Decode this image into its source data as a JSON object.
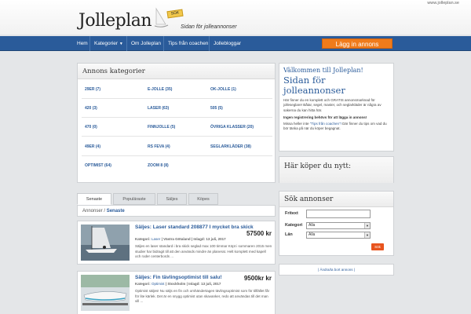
{
  "header": {
    "site_url": "www.jolleplan.se",
    "logo_text": "Jolleplan",
    "logo_badge": "SOK",
    "tagline": "Sidan för jolleannonser"
  },
  "nav": {
    "items": [
      "Hem",
      "Kategorier",
      "Om Jolleplan",
      "Tips från coachen",
      "Jollebloggar"
    ],
    "dropdown_icon": "caret-down-icon",
    "cta_label": "Lägg in annons"
  },
  "categories": {
    "title": "Annons kategorier",
    "items": [
      "29ER (7)",
      "E-JOLLE (35)",
      "OK-JOLLE (1)",
      "420 (3)",
      "LASER (63)",
      "505 (5)",
      "470 (0)",
      "FINNJOLLE (5)",
      "ÖVRIGA KLASSER (20)",
      "49ER (4)",
      "RS FEVA (4)",
      "SEGLARKLÄDER (38)",
      "OPTIMIST (64)",
      "ZOOM 8 (8)",
      ""
    ]
  },
  "tabs": {
    "items": [
      "Senaste",
      "Populäraste",
      "Säljes",
      "Köpes"
    ],
    "active": "Senaste"
  },
  "breadcrumb": {
    "root": "Annonser",
    "separator": "/",
    "current": "Senaste"
  },
  "listings": [
    {
      "title": "Säljes: Laser standard 208877 I mycket bra skick",
      "price": "57500 kr",
      "meta_prefix": "Kategori:",
      "category": "Laser",
      "meta_suffix": "| Västra Götaland | Inlagd: 13 juli, 2017",
      "description": "Säljes en laser standard i bra skick seglad max 100 timmar Köpt i sommaren 2015 men studier har bidragit till att den används mindre än planerat. Helt komplett med kapell och roder centerbords ..."
    },
    {
      "title": "Säljes: Fin tävlingsoptimist till salu!",
      "price": "9500kr kr",
      "meta_prefix": "Kategori:",
      "category": "Optimist",
      "meta_suffix": "| Stockholm | Inlagd: 13 juli, 2017",
      "description": "Optimist säljes! Nu säljs en fin och omhändertagen tävlingsoptimist som för tillfället får för lite kärlek. Det är en snygg optimist utan skavanker, redo att användas till det man vill ..."
    }
  ],
  "welcome": {
    "greeting": "Välkommen till Jolleplan!",
    "headline": "Sidan för jolleannonser",
    "body": "Här finner du en komplett och GRATIS annonsmarknad för jolleseglare! Båtar, segel, master, och seglarkläder är några av sakerna du kan hitta här.",
    "bold_line": "Ingen registrering behövs för att lägga in annons!",
    "note_prefix": "Missa heller inte",
    "note_link": "\"Tips från coachen\"!",
    "note_suffix": "Där finner du tips om vad du bör tänka på när du köper begagnat."
  },
  "wanted": {
    "title": "Här köper du nytt:"
  },
  "search": {
    "title": "Sök annonser",
    "text_label": "Fritext",
    "category_label": "Kategori",
    "category_value": "Alla",
    "region_label": "Län",
    "region_value": "Alla",
    "button_label": "Sök"
  },
  "remove_link": "| Ändra/ta bort annons |",
  "colors": {
    "nav_blue": "#2a5b9a",
    "cta_orange": "#f07b1b",
    "search_button": "#e8541e",
    "logo_badge": "#f2c84b"
  }
}
